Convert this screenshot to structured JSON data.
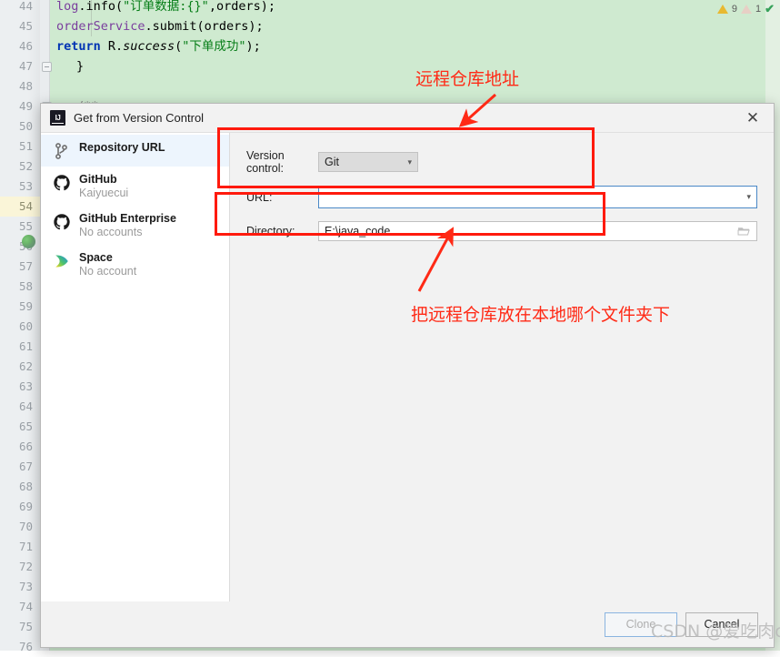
{
  "editor": {
    "lines": [
      {
        "num": "44",
        "breakpoint": false,
        "highlight": false
      },
      {
        "num": "45",
        "breakpoint": false,
        "highlight": false
      },
      {
        "num": "46",
        "breakpoint": false,
        "highlight": false
      },
      {
        "num": "47",
        "breakpoint": false,
        "highlight": false
      },
      {
        "num": "48",
        "breakpoint": false,
        "highlight": false
      },
      {
        "num": "49",
        "breakpoint": false,
        "highlight": false
      },
      {
        "num": "50",
        "breakpoint": false,
        "highlight": false
      },
      {
        "num": "51",
        "breakpoint": false,
        "highlight": false
      },
      {
        "num": "52",
        "breakpoint": false,
        "highlight": false
      },
      {
        "num": "53",
        "breakpoint": false,
        "highlight": false
      },
      {
        "num": "54",
        "breakpoint": false,
        "highlight": true
      },
      {
        "num": "55",
        "breakpoint": false,
        "highlight": false
      },
      {
        "num": "56",
        "breakpoint": false,
        "highlight": false
      },
      {
        "num": "57",
        "breakpoint": true,
        "highlight": false
      },
      {
        "num": "58",
        "breakpoint": true,
        "highlight": false
      },
      {
        "num": "59",
        "breakpoint": true,
        "highlight": false
      },
      {
        "num": "60",
        "breakpoint": true,
        "highlight": false
      },
      {
        "num": "61",
        "breakpoint": true,
        "highlight": false
      },
      {
        "num": "62",
        "breakpoint": true,
        "highlight": false
      },
      {
        "num": "63",
        "breakpoint": true,
        "highlight": false
      },
      {
        "num": "64",
        "breakpoint": true,
        "highlight": false
      },
      {
        "num": "65",
        "breakpoint": false,
        "highlight": false
      },
      {
        "num": "66",
        "breakpoint": false,
        "highlight": false
      },
      {
        "num": "67",
        "breakpoint": false,
        "highlight": false
      },
      {
        "num": "68",
        "breakpoint": false,
        "highlight": false
      },
      {
        "num": "69",
        "breakpoint": false,
        "highlight": false
      },
      {
        "num": "70",
        "breakpoint": false,
        "highlight": false
      },
      {
        "num": "71",
        "breakpoint": true,
        "highlight": false
      },
      {
        "num": "72",
        "breakpoint": true,
        "highlight": false
      },
      {
        "num": "73",
        "breakpoint": true,
        "highlight": false
      },
      {
        "num": "74",
        "breakpoint": true,
        "highlight": false
      },
      {
        "num": "75",
        "breakpoint": false,
        "highlight": false
      },
      {
        "num": "76",
        "breakpoint": false,
        "highlight": false
      }
    ],
    "code": {
      "line44_a": "log",
      "line44_b": ".info(",
      "line44_c": "\"订单数据:{}\"",
      "line44_d": ",orders);",
      "line45_a": "orderService",
      "line45_b": ".submit(orders);",
      "line46_a": "return",
      "line46_b": " R.",
      "line46_c": "success",
      "line46_d": "(",
      "line46_e": "\"下单成功\"",
      "line46_f": ");",
      "line47": "}",
      "line49": "/**"
    },
    "inspection": {
      "warning_count": "9",
      "weak_warning_count": "1",
      "ok_mark": "✔"
    }
  },
  "dialog": {
    "title": "Get from Version Control",
    "app_icon": "intellij-idea-icon",
    "close_label": "✕",
    "sidebar": {
      "items": [
        {
          "title": "Repository URL",
          "subtitle": "",
          "icon": "git-branch-icon",
          "selected": true
        },
        {
          "title": "GitHub",
          "subtitle": "Kaiyuecui",
          "icon": "github-icon",
          "selected": false
        },
        {
          "title": "GitHub Enterprise",
          "subtitle": "No accounts",
          "icon": "github-icon",
          "selected": false
        },
        {
          "title": "Space",
          "subtitle": "No account",
          "icon": "jetbrains-space-icon",
          "selected": false
        }
      ]
    },
    "form": {
      "version_control_label": "Version control:",
      "version_control_value": "Git",
      "url_label": "URL:",
      "url_value": "",
      "url_placeholder": "",
      "directory_label": "Directory:",
      "directory_value": "E:\\java_code",
      "browse_icon": "folder-open-icon",
      "dropdown_icon": "chevron-down-icon"
    },
    "footer": {
      "clone_label": "Clone",
      "clone_disabled": true,
      "cancel_label": "Cancel"
    }
  },
  "annotations": {
    "top_text": "远程仓库地址",
    "bottom_text": "把远程仓库放在本地哪个文件夹下",
    "color": "#ff2a16"
  },
  "watermark": "CSDN @爱吃肉c"
}
